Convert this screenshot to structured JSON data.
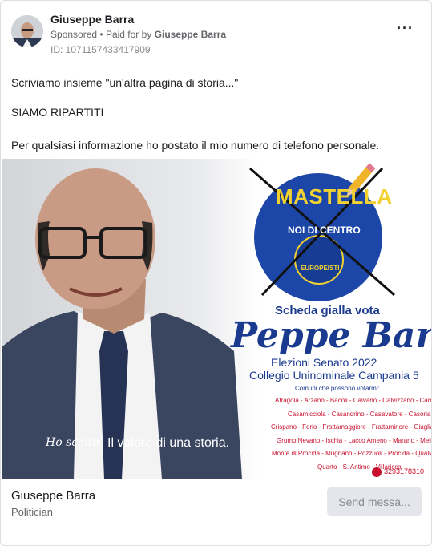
{
  "header": {
    "page_name": "Giuseppe Barra",
    "sponsored": "Sponsored",
    "separator": "•",
    "paid_for_prefix": "Paid for by",
    "paid_for_name": "Giuseppe Barra",
    "ad_id": "ID: 1071157433417909",
    "more_icon": "more-options-icon"
  },
  "body_text": {
    "line1": "Scriviamo insieme \"un'altra pagina di storia...\"",
    "line2": "SIAMO RIPARTITI",
    "line3": "Per qualsiasi informazione ho postato il mio numero di telefono personale."
  },
  "creative": {
    "logo_top": "MASTELLA",
    "logo_mid": "NOI DI CENTRO",
    "logo_bottom": "EUROPEISTI",
    "ballot_line": "Scheda gialla vota",
    "candidate": "Peppe Barra",
    "election": "Elezioni Senato 2022",
    "college": "Collegio Uninominale Campania 5",
    "voters_title": "Comuni che possono votarmi:",
    "towns": [
      "Afragola - Arzano - Bacoli - Caivano - Calvizzano - Cardito",
      "Casamicciola - Casandrino - Casavatore - Casoria",
      "Crispano - Forio - Frattamaggiore - Frattaminore - Giugliano",
      "Grumo Nevano - Ischia - Lacco Ameno - Marano - Melito",
      "Monte di Procida - Mugnano - Pozzuoli - Procida - Qualiano",
      "Quarto - S. Antimo - Villaricca"
    ],
    "phone": "3293178310",
    "tagline_script": "Ho scelto",
    "tagline": "Il valore di una storia.",
    "colors": {
      "logo_blue": "#1c46a8",
      "logo_yellow": "#f2d230",
      "candidate_blue": "#1a3a8f",
      "town_red": "#c8102e"
    }
  },
  "footer": {
    "name": "Giuseppe Barra",
    "category": "Politician",
    "cta": "Send messa..."
  }
}
